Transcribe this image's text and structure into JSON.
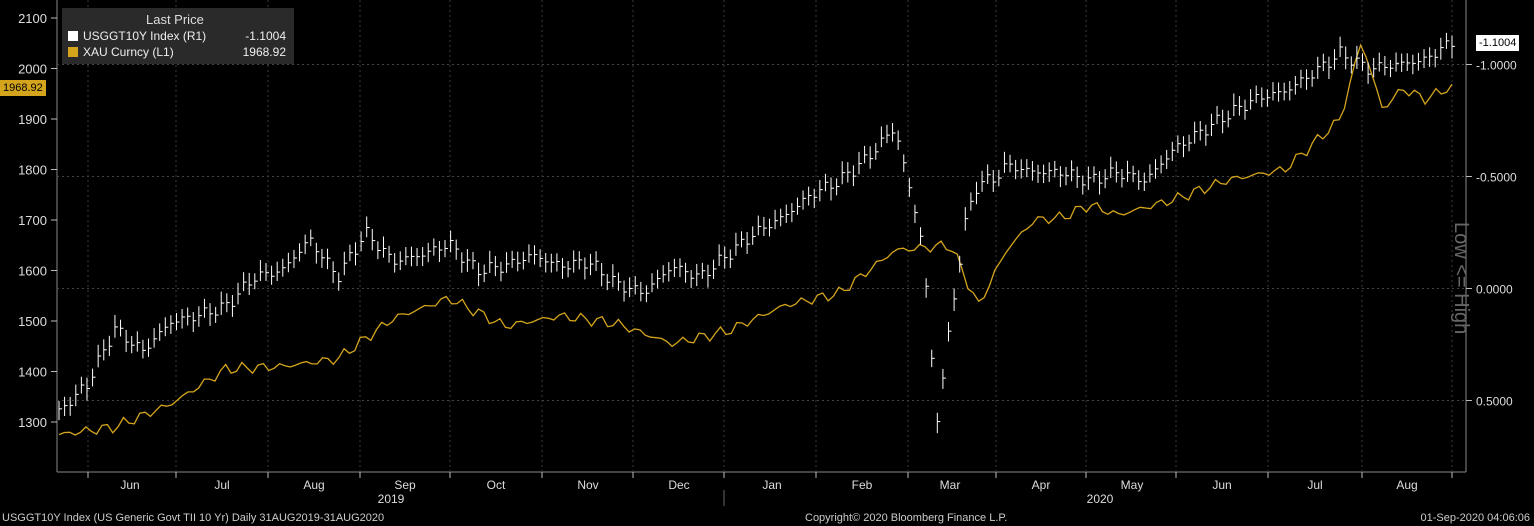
{
  "legend": {
    "header": "Last Price",
    "series": [
      {
        "name": "USGGT10Y Index  (R1)",
        "value": "-1.1004",
        "color": "#ffffff"
      },
      {
        "name": "XAU Curncy  (L1)",
        "value": "1968.92",
        "color": "#d4a51c"
      }
    ]
  },
  "tags": {
    "left_value": "1968.92",
    "right_value": "-1.1004"
  },
  "footer": {
    "left": "USGGT10Y Index (US Generic Govt TII 10 Yr)  Daily 31AUG2019-31AUG2020",
    "center": "Copyright© 2020 Bloomberg Finance L.P.",
    "right": "01-Sep-2020 04:06:06"
  },
  "right_axis_title": "Low <= High",
  "colors": {
    "background": "#000000",
    "gold": "#d4a51c",
    "bars": "#ffffff",
    "grid": "#555555"
  },
  "chart_data": {
    "type": "line",
    "x_months": [
      "Jun",
      "Jul",
      "Aug",
      "Sep",
      "Oct",
      "Nov",
      "Dec",
      "Jan",
      "Feb",
      "Mar",
      "Apr",
      "May",
      "Jun",
      "Jul",
      "Aug"
    ],
    "x_years": [
      "2019",
      "2020"
    ],
    "left_axis": {
      "ticks": [
        1300,
        1400,
        1500,
        1600,
        1700,
        1800,
        1900,
        2000,
        2100
      ],
      "range": [
        1200,
        2100
      ]
    },
    "right_axis": {
      "ticks": [
        "-1.0000",
        "-0.5000",
        "0.0000",
        "0.5000"
      ],
      "inverted": true,
      "range": [
        -1.4,
        0.8
      ]
    },
    "grid": true,
    "series": [
      {
        "name": "XAU Curncy",
        "axis": "left",
        "style": "line",
        "color": "#d4a51c",
        "x": [
          0,
          0.04,
          0.08,
          0.12,
          0.16,
          0.2,
          0.24,
          0.28,
          0.32,
          0.36,
          0.4,
          0.44,
          0.48,
          0.52,
          0.56,
          0.6,
          0.64,
          0.66,
          0.68,
          0.7,
          0.72,
          0.74,
          0.76,
          0.8,
          0.84,
          0.88,
          0.92,
          0.935,
          0.95,
          0.965,
          0.98,
          0.99,
          1.0
        ],
        "y": [
          1275,
          1290,
          1335,
          1405,
          1410,
          1425,
          1505,
          1545,
          1490,
          1510,
          1495,
          1455,
          1480,
          1530,
          1555,
          1640,
          1650,
          1530,
          1640,
          1700,
          1705,
          1730,
          1710,
          1740,
          1780,
          1800,
          1900,
          2055,
          1920,
          1960,
          1940,
          1950,
          1968.92
        ]
      },
      {
        "name": "USGGT10Y Index",
        "axis": "right",
        "style": "hlc-bars",
        "color": "#ffffff",
        "x": [
          0,
          0.02,
          0.04,
          0.06,
          0.08,
          0.1,
          0.12,
          0.14,
          0.16,
          0.18,
          0.2,
          0.22,
          0.24,
          0.26,
          0.28,
          0.3,
          0.32,
          0.34,
          0.36,
          0.38,
          0.4,
          0.42,
          0.44,
          0.46,
          0.48,
          0.5,
          0.52,
          0.54,
          0.56,
          0.58,
          0.6,
          0.62,
          0.63,
          0.64,
          0.65,
          0.66,
          0.67,
          0.68,
          0.7,
          0.72,
          0.74,
          0.76,
          0.78,
          0.8,
          0.82,
          0.84,
          0.86,
          0.88,
          0.9,
          0.92,
          0.94,
          0.96,
          0.98,
          1.0
        ],
        "y": [
          0.55,
          0.43,
          0.18,
          0.28,
          0.15,
          0.12,
          0.08,
          -0.05,
          -0.08,
          -0.22,
          -0.05,
          -0.25,
          -0.12,
          -0.15,
          -0.2,
          -0.08,
          -0.1,
          -0.15,
          -0.1,
          -0.12,
          -0.02,
          0.02,
          -0.1,
          -0.05,
          -0.15,
          -0.25,
          -0.32,
          -0.42,
          -0.48,
          -0.58,
          -0.72,
          -0.2,
          0.6,
          0.15,
          -0.28,
          -0.48,
          -0.48,
          -0.55,
          -0.52,
          -0.52,
          -0.48,
          -0.52,
          -0.48,
          -0.62,
          -0.7,
          -0.78,
          -0.85,
          -0.88,
          -0.96,
          -1.05,
          -0.98,
          -1.0,
          -1.02,
          -1.1004
        ]
      }
    ]
  }
}
